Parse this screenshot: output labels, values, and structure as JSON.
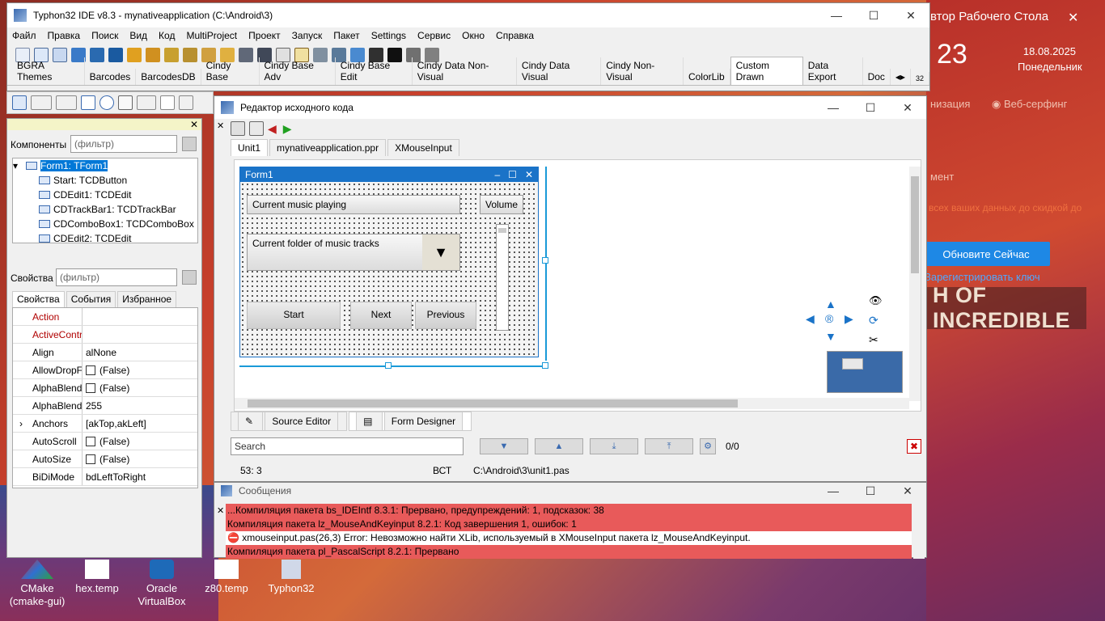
{
  "desktop": {
    "widget_title": "втор Рабочего Стола",
    "time": "23",
    "date": "18.08.2025",
    "day": "Понедельник",
    "org": "низация",
    "surf": "Веб-серфинг",
    "ment": "мент",
    "promo": "всех ваших данных до скидкой до",
    "update_btn": "Обновите Сейчас",
    "register": "Зарегистрировать ключ",
    "banner": "H OF INCREDIBLE",
    "icons": [
      {
        "label": "CMake (cmake-gui)"
      },
      {
        "label": "hex.temp"
      },
      {
        "label": "Oracle VirtualBox"
      },
      {
        "label": "z80.temp"
      },
      {
        "label": "Typhon32"
      }
    ]
  },
  "ide": {
    "title": "Typhon32 IDE v8.3 - mynativeapplication (C:\\Android\\3)",
    "menu": [
      "Файл",
      "Правка",
      "Поиск",
      "Вид",
      "Код",
      "MultiProject",
      "Проект",
      "Запуск",
      "Пакет",
      "Settings",
      "Сервис",
      "Окно",
      "Справка"
    ],
    "palette_tabs": [
      "BGRA Themes",
      "Barcodes",
      "BarcodesDB",
      "Cindy Base",
      "Cindy Base Adv",
      "Cindy Base Edit",
      "Cindy Data Non-Visual",
      "Cindy Data Visual",
      "Cindy Non-Visual",
      "ColorLib",
      "Custom Drawn",
      "Data Export",
      "Doc"
    ],
    "active_palette_tab": "Custom Drawn",
    "palette_counter": "32"
  },
  "inspector": {
    "components_label": "Компоненты",
    "filter_placeholder": "(фильтр)",
    "tree": [
      "Form1: TForm1",
      "Start: TCDButton",
      "CDEdit1: TCDEdit",
      "CDTrackBar1: TCDTrackBar",
      "CDComboBox1: TCDComboBox",
      "CDEdit2: TCDEdit"
    ],
    "props_label": "Свойства",
    "tabs": [
      "Свойства",
      "События",
      "Избранное"
    ],
    "properties": [
      {
        "name": "Action",
        "value": "",
        "red": true
      },
      {
        "name": "ActiveControl",
        "value": "",
        "red": true
      },
      {
        "name": "Align",
        "value": "alNone"
      },
      {
        "name": "AllowDropFiles",
        "value": "(False)",
        "check": true
      },
      {
        "name": "AlphaBlend",
        "value": "(False)",
        "check": true
      },
      {
        "name": "AlphaBlendValu",
        "value": "255"
      },
      {
        "name": "Anchors",
        "value": "[akTop,akLeft]",
        "expand": true
      },
      {
        "name": "AutoScroll",
        "value": "(False)",
        "check": true
      },
      {
        "name": "AutoSize",
        "value": "(False)",
        "check": true
      },
      {
        "name": "BiDiMode",
        "value": "bdLeftToRight"
      }
    ]
  },
  "editor": {
    "title": "Редактор исходного кода",
    "tabs": [
      "Unit1",
      "mynativeapplication.ppr",
      "XMouseInput"
    ],
    "form": {
      "title": "Form1",
      "edit1": "Current music playing",
      "volume": "Volume",
      "combo": "Current folder of music tracks",
      "btn_start": "Start",
      "btn_next": "Next",
      "btn_prev": "Previous"
    },
    "bottom_tabs": [
      "Source Editor",
      "Form Designer"
    ],
    "search_placeholder": "Search",
    "search_count": "0/0",
    "status": {
      "pos": "53:  3",
      "mode": "ВСТ",
      "file": "C:\\Android\\3\\unit1.pas"
    }
  },
  "messages": {
    "title": "Сообщения",
    "lines": [
      {
        "text": "...Компиляция пакета bs_IDEIntf 8.3.1: Прервано, предупреждений: 1, подсказок: 38",
        "type": "err"
      },
      {
        "text": "Компиляция пакета lz_MouseAndKeyinput 8.2.1: Код завершения 1, ошибок: 1",
        "type": "err"
      },
      {
        "text": "xmouseinput.pas(26,3) Error: Невозможно найти XLib, используемый в XMouseInput пакета lz_MouseAndKeyinput.",
        "type": "error-line"
      },
      {
        "text": "Компиляция пакета pl_PascalScript 8.2.1: Прервано",
        "type": "err"
      }
    ]
  }
}
